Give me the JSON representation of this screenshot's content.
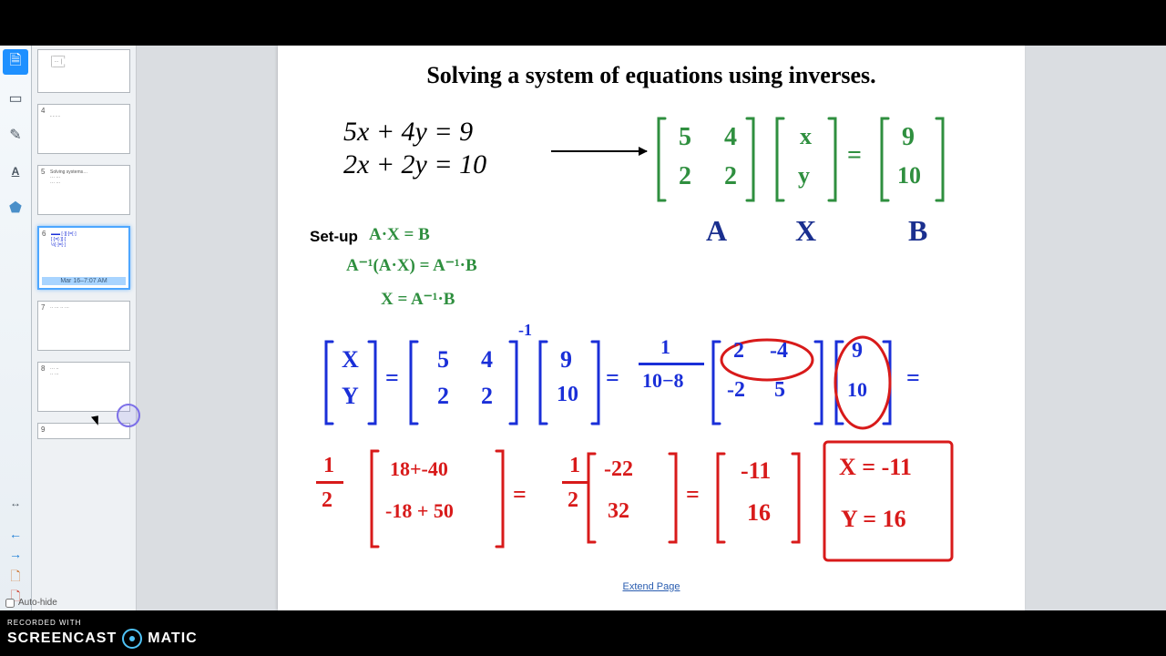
{
  "watermark": {
    "recorded": "RECORDED WITH",
    "left": "SCREENCAST",
    "right": "MATIC"
  },
  "toolbar": {
    "tools": [
      "file",
      "select",
      "pen",
      "text",
      "shapes"
    ],
    "expand_icon": "↔"
  },
  "thumbnails": {
    "items": [
      {
        "num": "",
        "caption": ""
      },
      {
        "num": "4",
        "caption": ""
      },
      {
        "num": "5",
        "caption": ""
      },
      {
        "num": "6",
        "caption": "Mar 16–7:07 AM"
      },
      {
        "num": "7",
        "caption": ""
      },
      {
        "num": "8",
        "caption": ""
      },
      {
        "num": "9",
        "caption": ""
      }
    ],
    "autohide_label": "Auto-hide"
  },
  "page": {
    "title": "Solving a system of equations using inverses.",
    "equations": {
      "line1": "5x + 4y = 9",
      "line2": "2x + 2y = 10"
    },
    "matrix_A": [
      [
        "5",
        "4"
      ],
      [
        "2",
        "2"
      ]
    ],
    "matrix_X": [
      "x",
      "y"
    ],
    "matrix_B": [
      "9",
      "10"
    ],
    "labels": {
      "A": "A",
      "X": "X",
      "B": "B"
    },
    "setup": {
      "label": "Set-up",
      "l1": "A·X = B",
      "l2": "A⁻¹(A·X) = A⁻¹·B",
      "l3": "X = A⁻¹·B"
    },
    "work": {
      "xy": [
        "X",
        "Y"
      ],
      "A": [
        [
          "5",
          "4"
        ],
        [
          "2",
          "2"
        ]
      ],
      "inv_exp": "-1",
      "B": [
        "9",
        "10"
      ],
      "det_frac": {
        "num": "1",
        "den": "10−8"
      },
      "adj": [
        [
          "2",
          "-4"
        ],
        [
          "-2",
          "5"
        ]
      ],
      "B2": [
        "9",
        "10"
      ],
      "step2_frac": "1/2",
      "step2_m1": [
        "18+-40",
        "-18 + 50"
      ],
      "step2_m2": [
        "-22",
        "32"
      ],
      "step2_m3": [
        "-11",
        "16"
      ],
      "solution": {
        "l1": "X = -11",
        "l2": "Y = 16"
      }
    },
    "extend": "Extend Page"
  }
}
